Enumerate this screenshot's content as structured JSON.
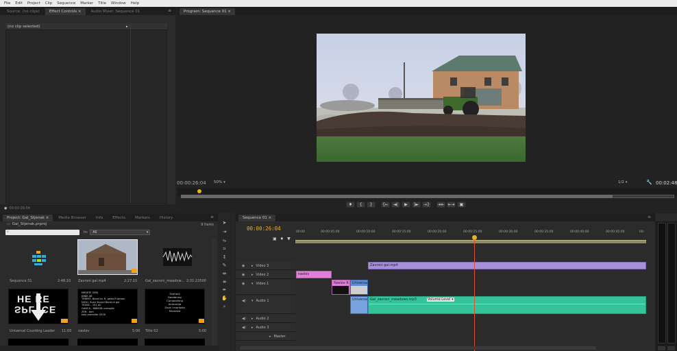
{
  "menu": [
    "File",
    "Edit",
    "Project",
    "Clip",
    "Sequence",
    "Marker",
    "Title",
    "Window",
    "Help"
  ],
  "source_panel": {
    "tabs": [
      "Source: (no clips)",
      "Effect Controls ×",
      "Audio Mixer: Sequence 01"
    ],
    "menu_icon": "≡",
    "no_clip_label": "(no clip selected)",
    "timecode": "00:00:26:04"
  },
  "program": {
    "tab": "Program: Sequence 01 ×",
    "timecode": "00:00:26:04",
    "zoom": "50%",
    "resolution": "1/2",
    "duration": "00:02:48",
    "transport_buttons": [
      "♦",
      "{",
      "}",
      "{←",
      "◄|",
      "▶",
      "|►",
      "→}",
      "⇥⇤",
      "⇤⇥",
      "▣"
    ]
  },
  "project": {
    "tabs": [
      "Project: Gal_Stjenak ×",
      "Media Browser",
      "Info",
      "Effects",
      "Markers",
      "History"
    ],
    "file": "Gal_Stjenak.prproj",
    "item_count": "9 Items",
    "in_label": "In:",
    "in_value": "All",
    "items": [
      {
        "name": "Sequence 01",
        "duration": "2:48:10"
      },
      {
        "name": "Zavrsni gal.mp4",
        "duration": "2:27:15"
      },
      {
        "name": "Gal_zavrsni_meadow...",
        "duration": "2:31:22500"
      },
      {
        "name": "Universal Counting Leader",
        "duration": "11:00"
      },
      {
        "name": "naslov",
        "duration": "5:00"
      },
      {
        "name": "Title 02",
        "duration": "5:00"
      }
    ],
    "leader_text_top": "HE RE",
    "leader_text_bottom": "SPL ICE",
    "title_text": [
      "MIRJETE GRIS",
      "JANIK AB",
      "TEBERT, Band kd, R. geles R.arman",
      "NICKI, Suan Sigurd Band ut gal",
      "TIGNIC - 101 as",
      "GANCA - 686458 unmsgile",
      "ZEN - ben",
      "kolo promsfor 2016"
    ],
    "title02_text": [
      "Scenarij",
      "Rendering",
      "Compositing",
      "Animacija",
      "Zvuk i montaža",
      "Montaža"
    ]
  },
  "timeline": {
    "tab": "Sequence 01 ×",
    "timecode": "00:00:26:04",
    "ruler": [
      "00:00",
      "00:00:05:00",
      "00:00:10:00",
      "00:00:15:00",
      "00:00:20:00",
      "00:00:25:00",
      "00:00:30:00",
      "00:00:35:00",
      "00:00:40:00",
      "00:00:45:00",
      "00:"
    ],
    "tracks": [
      "Video 3",
      "Video 2",
      "Video 1",
      "Audio 1",
      "Audio 2",
      "Audio 3",
      "Master"
    ],
    "clips": {
      "video3": "Zavrsni gal.mp4",
      "video2": "naslov",
      "video1_a": "Naslov R",
      "video1_b": "Universal",
      "audio1_a": "Universal",
      "audio1_b": "Gal_zavrsni_meadows.mp3",
      "audio1_vol": "Volume:Level ▾"
    }
  },
  "colors": {
    "accent_timecode": "#e8b41c",
    "clip_purple": "#a78fd9",
    "clip_pink": "#e07fd9",
    "clip_teal": "#35c49a",
    "playhead": "#e34d2f"
  }
}
